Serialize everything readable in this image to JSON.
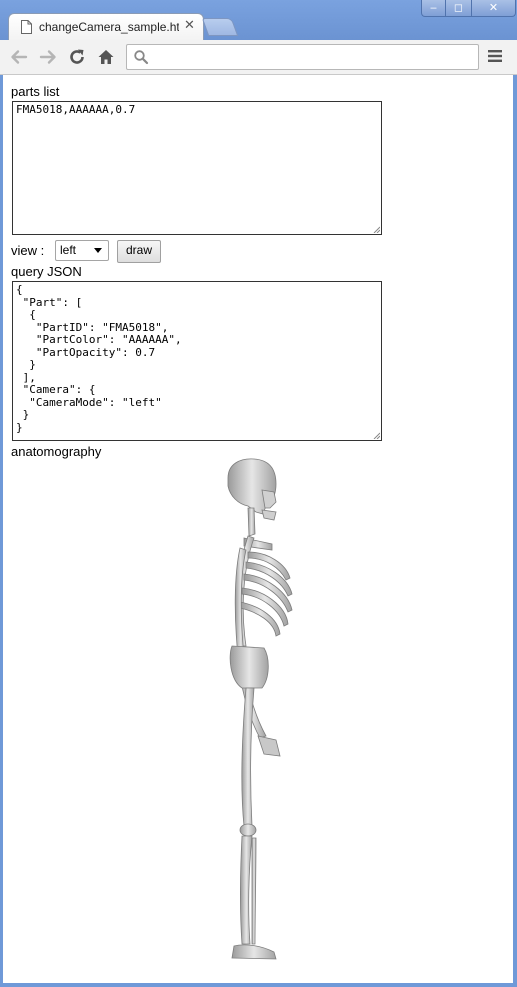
{
  "browser": {
    "tab_title": "changeCamera_sample.html",
    "address_value": "",
    "window_buttons": {
      "minimize": "‒",
      "maximize": "◻",
      "close": "✕"
    }
  },
  "icons": {
    "tab": "document-icon",
    "back": "back-arrow-icon",
    "forward": "forward-arrow-icon",
    "reload": "reload-icon",
    "home": "home-icon",
    "search": "search-icon",
    "menu": "hamburger-menu-icon"
  },
  "page": {
    "parts_list_label": "parts list",
    "parts_list_value": "FMA5018,AAAAAA,0.7",
    "view_label": "view :",
    "view_selected": "left",
    "draw_label": "draw",
    "query_json_label": "query JSON",
    "query_json_value": "{\n \"Part\": [\n  {\n   \"PartID\": \"FMA5018\",\n   \"PartColor\": \"AAAAAA\",\n   \"PartOpacity\": 0.7\n  }\n ],\n \"Camera\": {\n  \"CameraMode\": \"left\"\n }\n}",
    "anatomography_label": "anatomography"
  }
}
